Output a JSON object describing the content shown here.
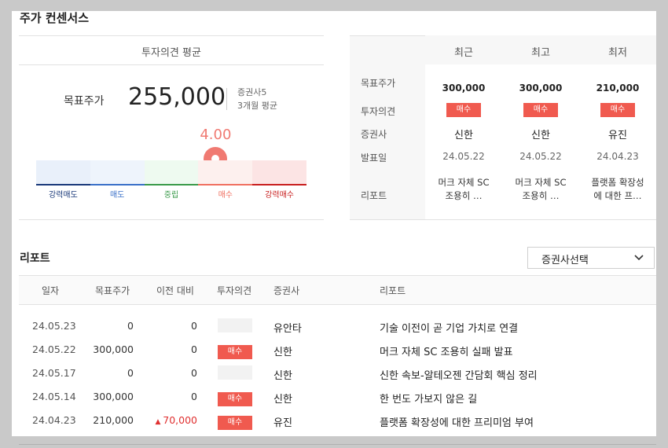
{
  "section_title": "주가 컨센서스",
  "left": {
    "header": "투자의견 평균",
    "target_label": "목표주가",
    "target_value": "255,000",
    "meta_line1": "증권사5",
    "meta_line2": "3개월 평균",
    "rating_value": "4.00",
    "rating_fraction": 0.75,
    "scale": [
      {
        "label": "강력매도",
        "color": "#1a3a7a",
        "bg": "#e9f0fa"
      },
      {
        "label": "매도",
        "color": "#3a70c8",
        "bg": "#eef4fc"
      },
      {
        "label": "중립",
        "color": "#3a9a4a",
        "bg": "#eefaf0"
      },
      {
        "label": "매수",
        "color": "#f07060",
        "bg": "#fdf0ee"
      },
      {
        "label": "강력매수",
        "color": "#c81e1e",
        "bg": "#fce4e4"
      }
    ],
    "accent": "#f07a72"
  },
  "right": {
    "columns": [
      "최근",
      "최고",
      "최저"
    ],
    "row_labels": [
      "목표주가",
      "투자의견",
      "증권사",
      "발표일",
      "리포트"
    ],
    "cells": [
      {
        "target": "300,000",
        "opinion": "매수",
        "broker": "신한",
        "date": "24.05.22",
        "report_l1": "머크 자체 SC",
        "report_l2": "조용히 …"
      },
      {
        "target": "300,000",
        "opinion": "매수",
        "broker": "신한",
        "date": "24.05.22",
        "report_l1": "머크 자체 SC",
        "report_l2": "조용히 …"
      },
      {
        "target": "210,000",
        "opinion": "매수",
        "broker": "유진",
        "date": "24.04.23",
        "report_l1": "플랫폼 확장성",
        "report_l2": "에 대한 프…"
      }
    ]
  },
  "reports": {
    "title": "리포트",
    "dropdown_label": "증권사선택",
    "headers": [
      "일자",
      "목표주가",
      "이전 대비",
      "투자의견",
      "증권사",
      "리포트"
    ],
    "rows": [
      {
        "date": "24.05.23",
        "target": "0",
        "change": "0",
        "change_up": false,
        "opinion": "",
        "broker": "유안타",
        "title": "기술 이전이 곧 기업 가치로 연결"
      },
      {
        "date": "24.05.22",
        "target": "300,000",
        "change": "0",
        "change_up": false,
        "opinion": "매수",
        "broker": "신한",
        "title": "머크 자체 SC 조용히 실패 발표"
      },
      {
        "date": "24.05.17",
        "target": "0",
        "change": "0",
        "change_up": false,
        "opinion": "",
        "broker": "신한",
        "title": "신한 속보-알테오젠 간담회 핵심 정리"
      },
      {
        "date": "24.05.14",
        "target": "300,000",
        "change": "0",
        "change_up": false,
        "opinion": "매수",
        "broker": "신한",
        "title": "한 번도 가보지 않은 길"
      },
      {
        "date": "24.04.23",
        "target": "210,000",
        "change": "70,000",
        "change_up": true,
        "opinion": "매수",
        "broker": "유진",
        "title": "플랫폼 확장성에 대한 프리미엄 부여"
      }
    ]
  }
}
